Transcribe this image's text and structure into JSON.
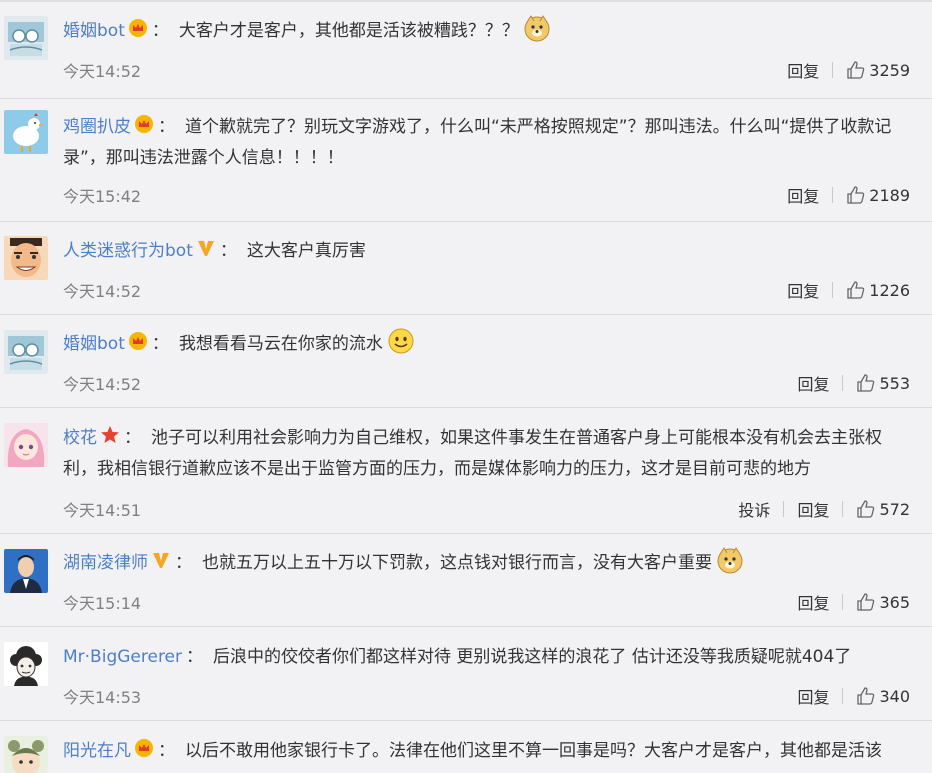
{
  "action_labels": {
    "reply": "回复",
    "report": "投诉"
  },
  "comments": [
    {
      "user": "婚姻bot",
      "badge": "crown-icon",
      "lines": [
        "大客户才是客户，其他都是活该被糟践？？？"
      ],
      "emoji": "doge-emoji-icon",
      "time": "今天14:52",
      "likes": "3259",
      "report": false
    },
    {
      "user": "鸡圈扒皮",
      "badge": "crown-icon",
      "lines": [
        "道个歉就完了？别玩文字游戏了，什么叫“未严格按照规定”？那叫违法。什么叫“提供了收款记",
        "录”，那叫违法泄露个人信息！！！！"
      ],
      "emoji": "",
      "time": "今天15:42",
      "likes": "2189",
      "report": false
    },
    {
      "user": "人类迷惑行为bot",
      "badge": "verified-v-icon",
      "lines": [
        "这大客户真厉害"
      ],
      "emoji": "",
      "time": "今天14:52",
      "likes": "1226",
      "report": false
    },
    {
      "user": "婚姻bot",
      "badge": "crown-icon",
      "lines": [
        "我想看看马云在你家的流水"
      ],
      "emoji": "smile-emoji-icon",
      "time": "今天14:52",
      "likes": "553",
      "report": false
    },
    {
      "user": "校花",
      "badge": "star-icon",
      "lines": [
        "池子可以利用社会影响力为自己维权，如果这件事发生在普通客户身上可能根本没有机会去主张权",
        "利，我相信银行道歉应该不是出于监管方面的压力，而是媒体影响力的压力，这才是目前可悲的地方"
      ],
      "emoji": "",
      "time": "今天14:51",
      "likes": "572",
      "report": true
    },
    {
      "user": "湖南凌律师",
      "badge": "verified-v-icon",
      "lines": [
        "也就五万以上五十万以下罚款，这点钱对银行而言，没有大客户重要"
      ],
      "emoji": "doge-emoji-icon",
      "time": "今天15:14",
      "likes": "365",
      "report": false
    },
    {
      "user": "Mr·BigGererer",
      "badge": "",
      "lines": [
        "后浪中的佼佼者你们都这样对待 更别说我这样的浪花了 估计还没等我质疑呢就404了"
      ],
      "emoji": "",
      "time": "今天14:53",
      "likes": "340",
      "report": false
    },
    {
      "user": "阳光在凡",
      "badge": "crown-icon",
      "lines": [
        "以后不敢用他家银行卡了。法律在他们这里不算一回事是吗？大客户才是客户，其他都是活该"
      ],
      "emoji": "",
      "time": "",
      "likes": "",
      "report": false
    }
  ]
}
